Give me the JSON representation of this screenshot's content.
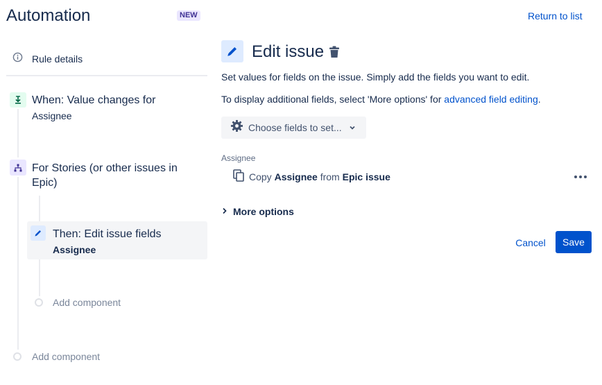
{
  "header": {
    "title": "Automation",
    "badge": "NEW",
    "return_link": "Return to list"
  },
  "sidebar": {
    "rule_details": {
      "label": "Rule details",
      "icon": "info-icon"
    },
    "trigger": {
      "title": "When: Value changes for",
      "subtitle": "Assignee",
      "icon": "trigger-icon",
      "color": "#e3fcef"
    },
    "branch": {
      "title": "For Stories (or other issues in Epic)",
      "icon": "branch-icon",
      "color": "#eae6ff"
    },
    "action": {
      "title": "Then: Edit issue fields",
      "subtitle": "Assignee",
      "icon": "pencil-icon",
      "color": "#deebff"
    },
    "add_component_inner": "Add component",
    "add_component_outer": "Add component"
  },
  "main": {
    "title": "Edit issue",
    "description_1": "Set values for fields on the issue. Simply add the fields you want to edit.",
    "description_2_prefix": "To display additional fields, select 'More options' for ",
    "description_2_link": "advanced field editing",
    "description_2_suffix": ".",
    "choose_fields_button": "Choose fields to set...",
    "field": {
      "label": "Assignee",
      "copy_prefix": "Copy ",
      "copy_field": "Assignee",
      "copy_from": " from ",
      "copy_source": "Epic issue"
    },
    "more_options": "More options",
    "cancel": "Cancel",
    "save": "Save"
  },
  "colors": {
    "brand": "#0052cc",
    "text": "#172b4d",
    "muted": "#7a869a",
    "card_bg": "#f4f5f7"
  }
}
